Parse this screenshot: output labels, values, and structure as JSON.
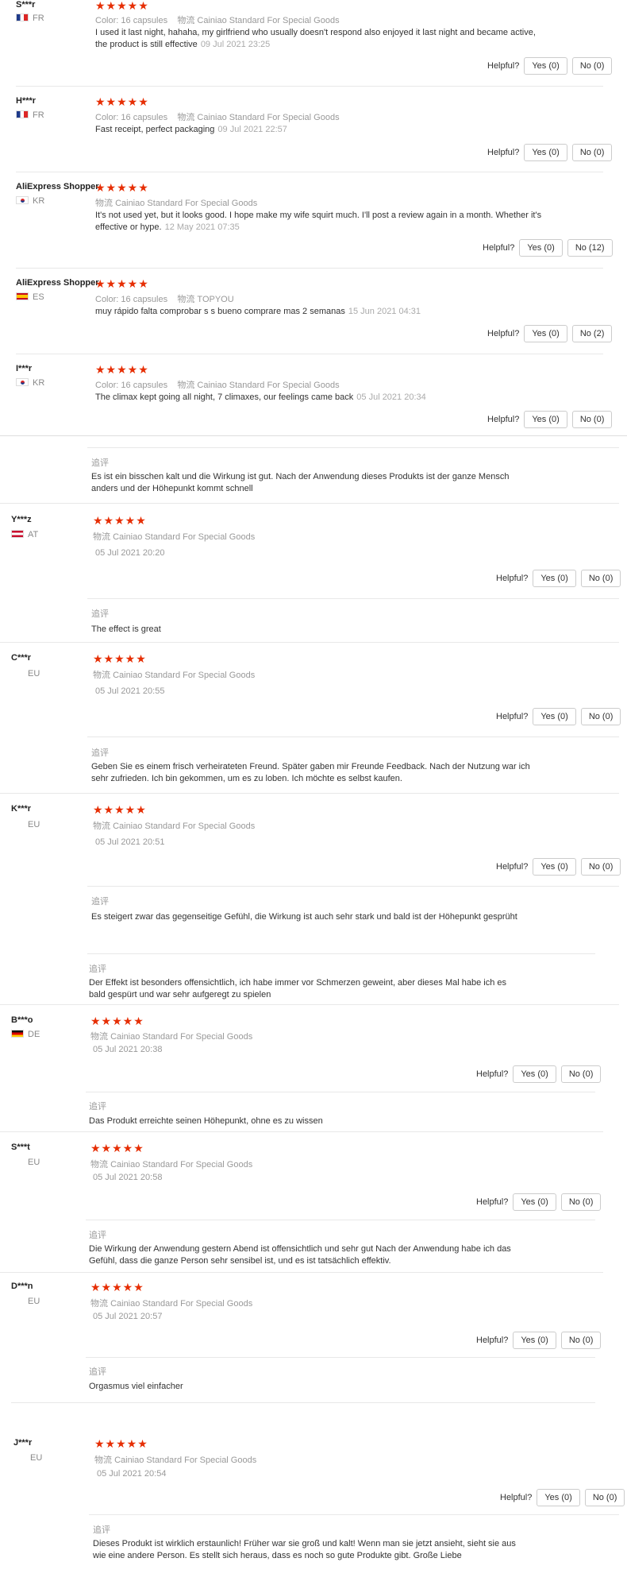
{
  "labels": {
    "color": "Color:",
    "logistics": "物流",
    "helpful": "Helpful?",
    "additional": "追评"
  },
  "reviews": [
    {
      "user": "S***r",
      "country": "FR",
      "stars": "★★★★★",
      "color_value": "16 capsules",
      "logistics_value": "Cainiao Standard For Special Goods",
      "text": "I used it last night, hahaha, my girlfriend who usually doesn't respond also enjoyed it last night and became active, the product is still effective",
      "date": "09 Jul 2021 23:25",
      "yes": "Yes (0)",
      "no": "No (0)"
    },
    {
      "user": "H***r",
      "country": "FR",
      "stars": "★★★★★",
      "color_value": "16 capsules",
      "logistics_value": "Cainiao Standard For Special Goods",
      "text": "Fast receipt, perfect packaging",
      "date": "09 Jul 2021 22:57",
      "yes": "Yes (0)",
      "no": "No (0)"
    },
    {
      "user": "AliExpress Shopper",
      "country": "KR",
      "stars": "★★★★★",
      "logistics_value": "Cainiao Standard For Special Goods",
      "text": "It's not used yet, but it looks good. I hope make my wife squirt much. I'll post a review again in a month. Whether it's effective or hype.",
      "date": "12 May 2021 07:35",
      "yes": "Yes (0)",
      "no": "No (12)"
    },
    {
      "user": "AliExpress Shopper",
      "country": "ES",
      "stars": "★★★★★",
      "color_value": "16 capsules",
      "logistics_value": "TOPYOU",
      "text": "muy rápido falta comprobar s s bueno comprare mas 2 semanas",
      "date": "15 Jun 2021 04:31",
      "yes": "Yes (0)",
      "no": "No (2)"
    },
    {
      "user": "I***r",
      "country": "KR",
      "stars": "★★★★★",
      "color_value": "16 capsules",
      "logistics_value": "Cainiao Standard For Special Goods",
      "text": "The climax kept going all night, 7 climaxes, our feelings came back",
      "date": "05 Jul 2021 20:34",
      "yes": "Yes (0)",
      "no": "No (0)"
    }
  ],
  "followup_top": "Es ist ein bisschen kalt und die Wirkung ist gut. Nach der Anwendung dieses Produkts ist der ganze Mensch anders und der Höhepunkt kommt schnell",
  "lower_reviews": [
    {
      "user": "Y***z",
      "country": "AT",
      "stars": "★★★★★",
      "logistics_value": "Cainiao Standard For Special Goods",
      "date": "05 Jul 2021 20:20",
      "yes": "Yes (0)",
      "no": "No (0)",
      "followup": "The effect is great"
    },
    {
      "user": "C***r",
      "country": "EU",
      "stars": "★★★★★",
      "logistics_value": "Cainiao Standard For Special Goods",
      "date": "05 Jul 2021 20:55",
      "yes": "Yes (0)",
      "no": "No (0)",
      "followup": "Geben Sie es einem frisch verheirateten Freund. Später gaben mir Freunde Feedback. Nach der Nutzung war ich sehr zufrieden. Ich bin gekommen, um es zu loben. Ich möchte es selbst kaufen."
    },
    {
      "user": "K***r",
      "country": "EU",
      "stars": "★★★★★",
      "logistics_value": "Cainiao Standard For Special Goods",
      "date": "05 Jul 2021 20:51",
      "yes": "Yes (0)",
      "no": "No (0)",
      "followup": "Es steigert zwar das gegenseitige Gefühl, die Wirkung ist auch sehr stark und bald ist der Höhepunkt gesprüht"
    },
    {
      "user": "B***o",
      "country": "DE",
      "stars": "★★★★★",
      "logistics_value": "Cainiao Standard For Special Goods",
      "date": "05 Jul 2021 20:38",
      "yes": "Yes (0)",
      "no": "No (0)",
      "followup_before": "Der Effekt ist besonders offensichtlich, ich habe immer vor Schmerzen geweint, aber dieses Mal habe ich es bald gespürt und war sehr aufgeregt zu spielen",
      "followup": "Das Produkt erreichte seinen Höhepunkt, ohne es zu wissen"
    },
    {
      "user": "S***t",
      "country": "EU",
      "stars": "★★★★★",
      "logistics_value": "Cainiao Standard For Special Goods",
      "date": "05 Jul 2021 20:58",
      "yes": "Yes (0)",
      "no": "No (0)",
      "followup": "Die Wirkung der Anwendung gestern Abend ist offensichtlich und sehr gut Nach der Anwendung habe ich das Gefühl, dass die ganze Person sehr sensibel ist, und es ist tatsächlich effektiv."
    },
    {
      "user": "D***n",
      "country": "EU",
      "stars": "★★★★★",
      "logistics_value": "Cainiao Standard For Special Goods",
      "date": "05 Jul 2021 20:57",
      "yes": "Yes (0)",
      "no": "No (0)",
      "followup": "Orgasmus viel einfacher"
    },
    {
      "user": "J***r",
      "country": "EU",
      "stars": "★★★★★",
      "logistics_value": "Cainiao Standard For Special Goods",
      "date": "05 Jul 2021 20:54",
      "yes": "Yes (0)",
      "no": "No (0)",
      "followup": "Dieses Produkt ist wirklich erstaunlich! Früher war sie groß und kalt! Wenn man sie jetzt ansieht, sieht sie aus wie eine andere Person. Es stellt sich heraus, dass es noch so gute Produkte gibt. Große Liebe"
    }
  ]
}
